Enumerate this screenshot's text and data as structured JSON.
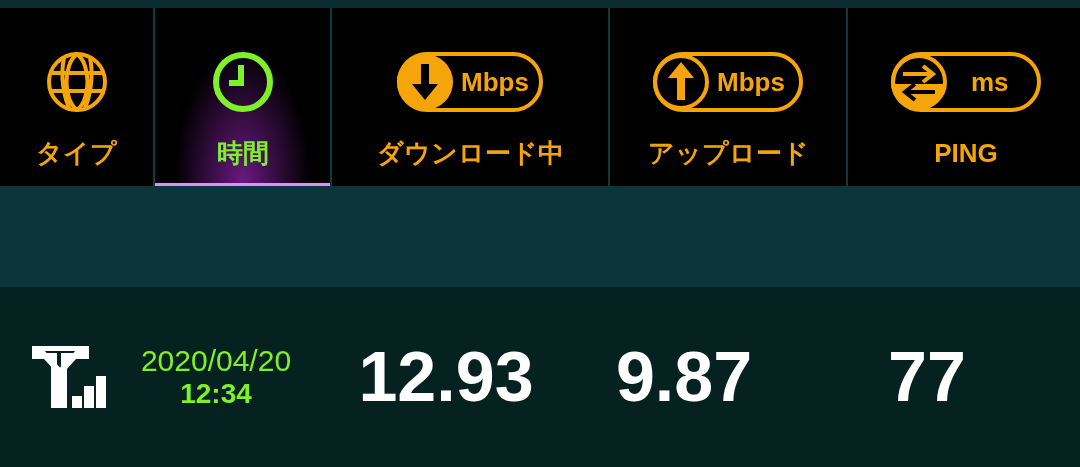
{
  "tabs": [
    {
      "kind": "globe",
      "label": "タイプ",
      "selected": false
    },
    {
      "kind": "clock",
      "label": "時間",
      "selected": true
    },
    {
      "kind": "download",
      "unit": "Mbps",
      "label": "ダウンロード中",
      "selected": false
    },
    {
      "kind": "upload",
      "unit": "Mbps",
      "label": "アップロード",
      "selected": false
    },
    {
      "kind": "ping",
      "unit": "ms",
      "label": "PING",
      "selected": false
    }
  ],
  "result": {
    "date": "2020/04/20",
    "time": "12:34",
    "download": "12.93",
    "upload": "9.87",
    "ping": "77"
  }
}
